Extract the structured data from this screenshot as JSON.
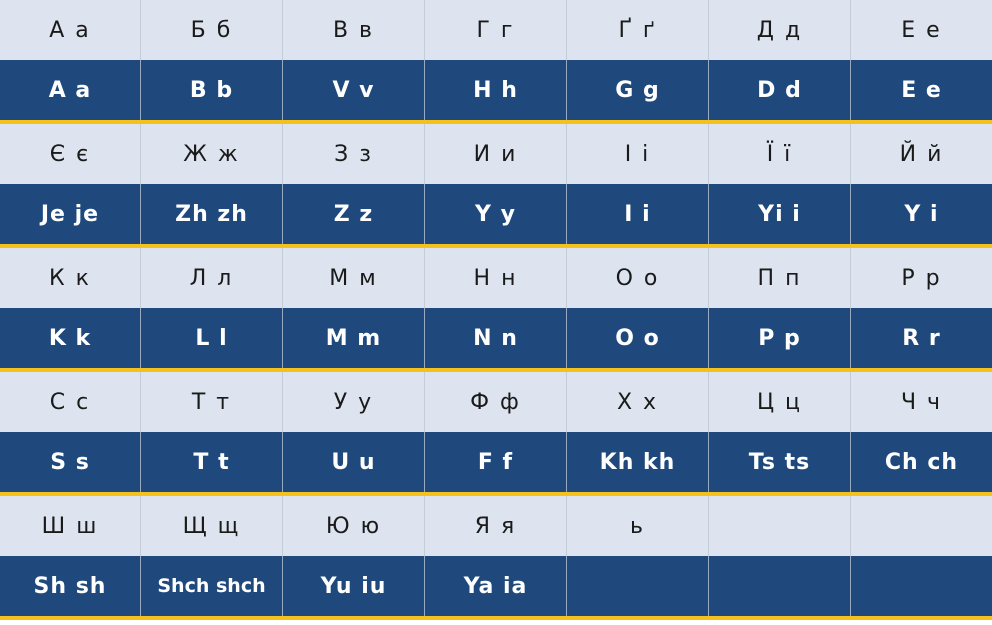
{
  "alphabet": {
    "pairs": [
      {
        "cyrillic": [
          "А а",
          "Б б",
          "В в",
          "Г г",
          "Ґ ґ",
          "Д д",
          "Е е"
        ],
        "latin": [
          "A a",
          "B b",
          "V v",
          "H h",
          "G g",
          "D d",
          "E e"
        ]
      },
      {
        "cyrillic": [
          "Є є",
          "Ж ж",
          "З з",
          "И и",
          "І і",
          "Ї ї",
          "Й й"
        ],
        "latin": [
          "Je je",
          "Zh zh",
          "Z z",
          "Y y",
          "I i",
          "Yi i",
          "Y i"
        ]
      },
      {
        "cyrillic": [
          "К к",
          "Л л",
          "М м",
          "Н н",
          "О о",
          "П п",
          "Р р"
        ],
        "latin": [
          "K k",
          "L l",
          "M m",
          "N n",
          "O o",
          "P p",
          "R r"
        ]
      },
      {
        "cyrillic": [
          "С с",
          "Т т",
          "У у",
          "Ф ф",
          "Х х",
          "Ц ц",
          "Ч ч"
        ],
        "latin": [
          "S s",
          "T t",
          "U u",
          "F f",
          "Kh kh",
          "Ts ts",
          "Ch ch"
        ]
      },
      {
        "cyrillic": [
          "Ш ш",
          "Щ щ",
          "Ю ю",
          "Я я",
          "ь",
          "",
          ""
        ],
        "latin": [
          "Sh sh",
          "Shch shch",
          "Yu iu",
          "Ya ia",
          "",
          "",
          ""
        ]
      }
    ]
  },
  "colors": {
    "cyrillic_row_bg": "#dde4ef",
    "latin_row_bg": "#1f497d",
    "separator": "#f4c21b",
    "latin_text": "#ffffff",
    "cyrillic_text": "#1a1a1a"
  }
}
